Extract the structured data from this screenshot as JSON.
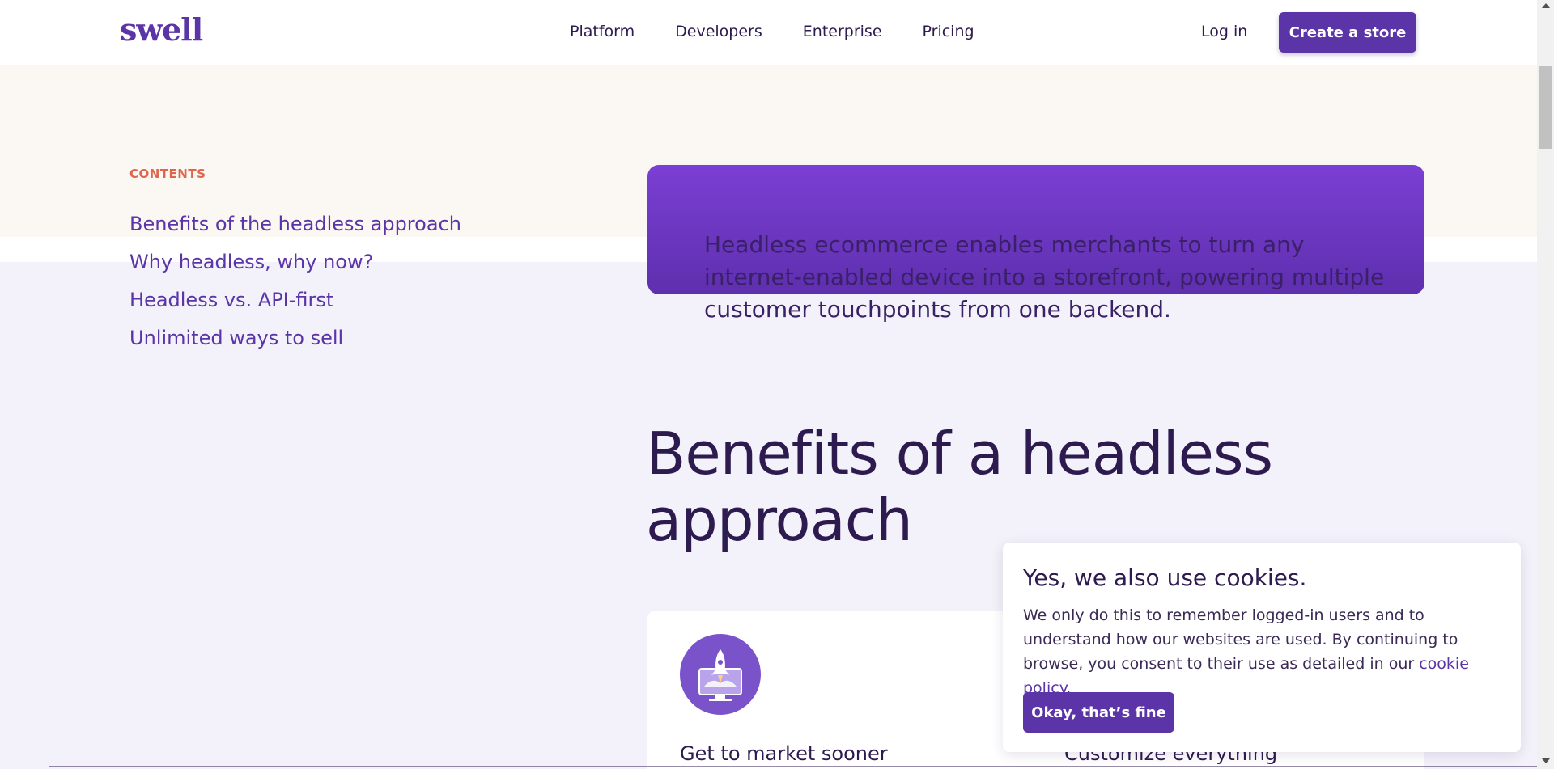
{
  "header": {
    "logo": "swell",
    "nav": [
      "Platform",
      "Developers",
      "Enterprise",
      "Pricing"
    ],
    "login_label": "Log in",
    "cta_label": "Create a store"
  },
  "contents": {
    "label": "CONTENTS",
    "items": [
      "Benefits of the headless approach",
      "Why headless, why now?",
      "Headless vs. API-first",
      "Unlimited ways to sell"
    ]
  },
  "banner": {
    "text": "Headless ecommerce enables merchants to turn any internet-enabled device into a storefront, powering multiple customer touchpoints from one backend."
  },
  "section": {
    "title": "Benefits of a headless approach"
  },
  "cards": [
    {
      "title": "Get to market sooner",
      "icon": "rocket-monitor-icon"
    },
    {
      "title": "Customize everything"
    }
  ],
  "cookie": {
    "title": "Yes, we also use cookies.",
    "body": "We only do this to remember logged-in users and to understand how our websites are used. By continuing to browse, you consent to their use as detailed in our",
    "link": "cookie policy",
    "period": ".",
    "button_label": "Okay, that’s fine"
  },
  "colors": {
    "brand_purple": "#5b35a8",
    "accent_coral": "#e0654d",
    "text_dark": "#2d1a4f"
  }
}
